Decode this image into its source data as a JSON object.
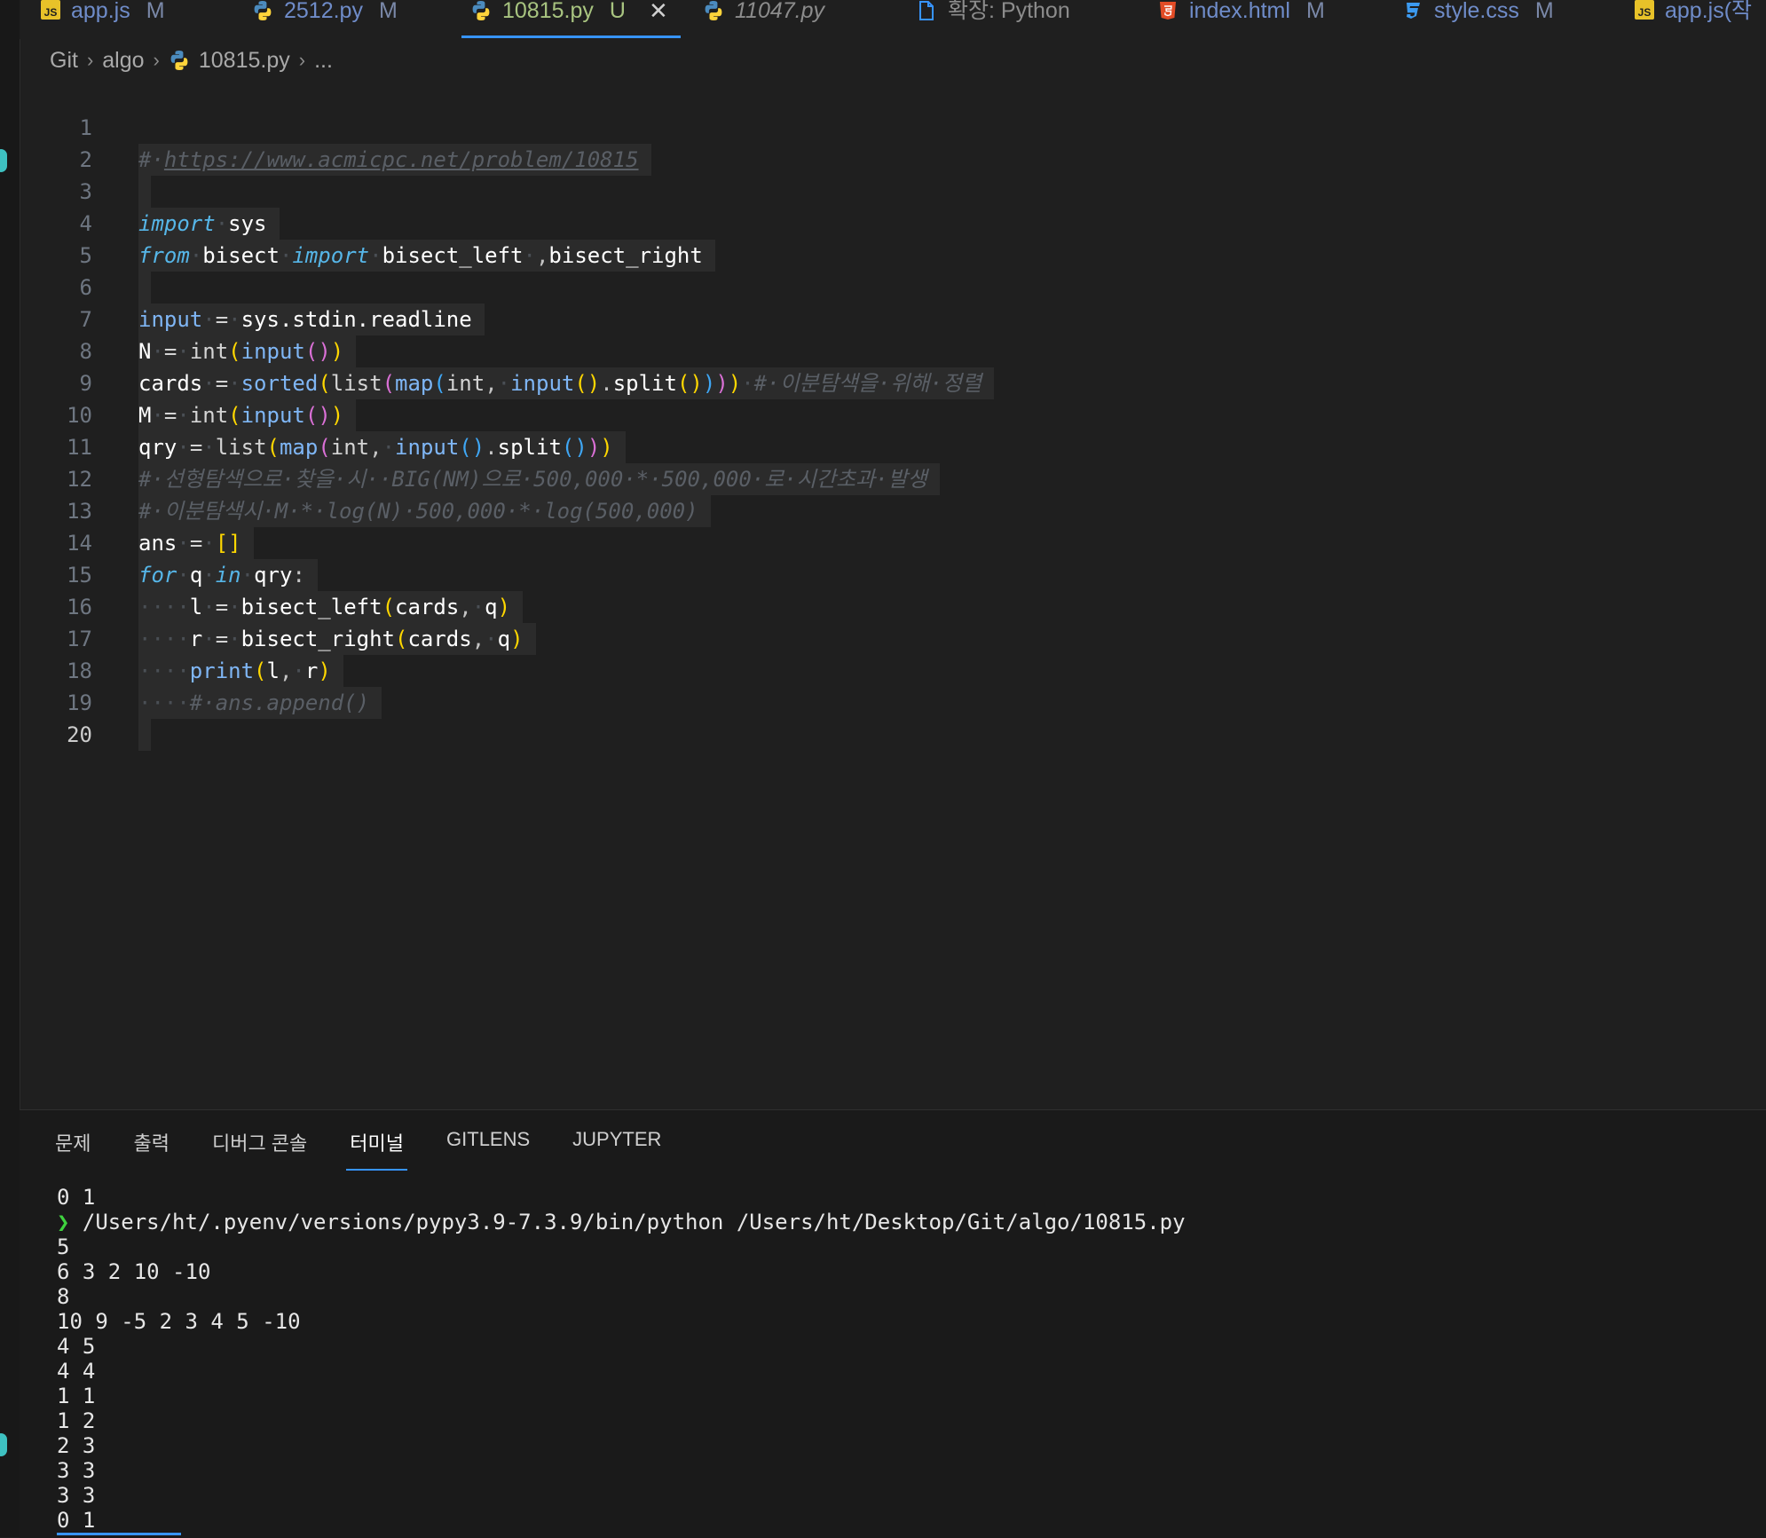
{
  "tabs": [
    {
      "icon": "js",
      "label": "app.js",
      "status": "M"
    },
    {
      "icon": "py",
      "label": "2512.py",
      "status": "M"
    },
    {
      "icon": "py",
      "label": "10815.py",
      "status": "U",
      "active": true
    },
    {
      "icon": "py",
      "label": "11047.py",
      "status": ""
    },
    {
      "icon": "doc",
      "label": "확장: Python",
      "status": ""
    },
    {
      "icon": "html",
      "label": "index.html",
      "status": "M"
    },
    {
      "icon": "css",
      "label": "style.css",
      "status": "M"
    },
    {
      "icon": "js",
      "label": "app.js(작",
      "status": ""
    }
  ],
  "breadcrumb": {
    "root": "Git",
    "folder": "algo",
    "file": "10815.py",
    "more": "..."
  },
  "editor": {
    "line_numbers": [
      "1",
      "2",
      "3",
      "4",
      "5",
      "6",
      "7",
      "8",
      "9",
      "10",
      "11",
      "12",
      "13",
      "14",
      "15",
      "16",
      "17",
      "18",
      "19",
      "20"
    ],
    "l1_comment_prefix": "#·",
    "l1_url": "https://www.acmicpc.net/problem/10815",
    "kw_import": "import",
    "kw_from": "from",
    "kw_for": "for",
    "kw_in": "in",
    "sys": "sys",
    "bisect": "bisect",
    "bisect_left": "bisect_left",
    "bisect_right": "bisect_right",
    "comma_sep": ",",
    "input": "input",
    "stdin_readline": "sys.stdin.readline",
    "int": "int",
    "sorted": "sorted",
    "list": "list",
    "map": "map",
    "split": "split",
    "print": "print",
    "N": "N",
    "M": "M",
    "cards": "cards",
    "qry": "qry",
    "ans": "ans",
    "q": "q",
    "l": "l",
    "r": "r",
    "l8_comment": "#·이분탐색을·위해·정렬",
    "l11_comment": "#·선형탐색으로·찾을·시··BIG(NM)으로·500,000·*·500,000·로·시간초과·발생",
    "l12_comment": "#·이분탐색시·M·*·log(N)·500,000·*·log(500,000)",
    "l18_comment": "#·ans.append()"
  },
  "panel": {
    "tabs": [
      "문제",
      "출력",
      "디버그 콘솔",
      "터미널",
      "GITLENS",
      "JUPYTER"
    ],
    "active_tab": "터미널",
    "terminal_lines": [
      "0 1",
      "/Users/ht/.pyenv/versions/pypy3.9-7.3.9/bin/python /Users/ht/Desktop/Git/algo/10815.py",
      "5",
      "6 3 2 10 -10",
      "8",
      "10 9 -5 2 3 4 5 -10",
      "4 5",
      "4 4",
      "1 1",
      "1 2",
      "2 3",
      "3 3",
      "3 3",
      "0 1"
    ],
    "prompt_symbol": "❯"
  },
  "colors": {
    "accent": "#3794ff",
    "editor_bg": "#1f1f1f",
    "panel_bg": "#1a1a1a",
    "prompt": "#3fd23f"
  }
}
